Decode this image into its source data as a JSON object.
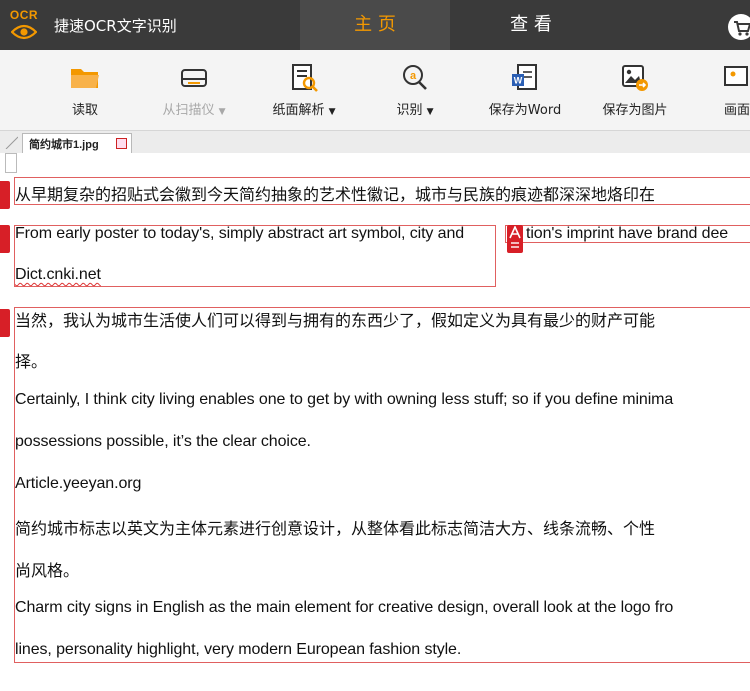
{
  "app": {
    "logo_text": "OCR",
    "title": "捷速OCR文字识别"
  },
  "nav": {
    "tabs": [
      {
        "label": "主 页",
        "active": true
      },
      {
        "label": "查 看",
        "active": false
      }
    ]
  },
  "toolbar": {
    "items": [
      {
        "label": "读取",
        "icon": "open-folder-icon",
        "enabled": true,
        "has_dropdown": false
      },
      {
        "label": "从扫描仪",
        "icon": "scanner-icon",
        "enabled": false,
        "has_dropdown": true
      },
      {
        "label": "纸面解析",
        "icon": "page-analysis-icon",
        "enabled": true,
        "has_dropdown": true
      },
      {
        "label": "识别",
        "icon": "recognize-icon",
        "enabled": true,
        "has_dropdown": true
      },
      {
        "label": "保存为Word",
        "icon": "word-doc-icon",
        "enabled": true,
        "has_dropdown": false
      },
      {
        "label": "保存为图片",
        "icon": "save-image-icon",
        "enabled": true,
        "has_dropdown": false
      },
      {
        "label": "画面",
        "icon": "screen-capture-icon",
        "enabled": true,
        "has_dropdown": false
      }
    ],
    "dropdown_glyph": "▼"
  },
  "document_tab": {
    "filename": "简约城市1.jpg"
  },
  "content": {
    "lines": [
      "从早期复杂的招贴式会徽到今天简约抽象的艺术性徽记，城市与民族的痕迹都深深地烙印在",
      "From early poster to today's, simply abstract art symbol, city and",
      "tion's imprint have brand dee",
      "Dict.cnki.net",
      "当然，我认为城市生活使人们可以得到与拥有的东西少了，假如定义为具有最少的财产可能",
      "择。",
      "Certainly, I think city living enables one to get by with owning less stuff; so if you define minima",
      "possessions possible, it’s the clear choice.",
      "Article.yeeyan.org",
      "简约城市标志以英文为主体元素进行创意设计，从整体看此标志简洁大方、线条流畅、个性",
      "尚风格。",
      "Charm city signs in English as the main element for creative design, overall look at the logo fro",
      "lines, personality highlight, very modern European fashion style."
    ]
  },
  "colors": {
    "accent": "#f39800",
    "titlebar": "#3a3a3a",
    "marker": "#d71f27",
    "block_border": "#e06060"
  }
}
